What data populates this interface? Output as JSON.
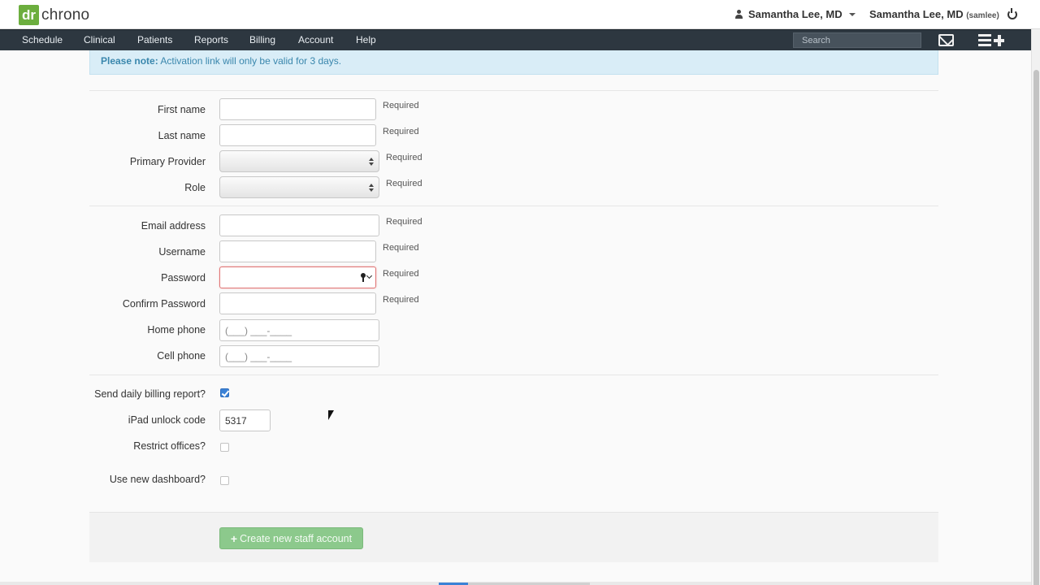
{
  "brand": {
    "logo_mark": "dr",
    "logo_text": "chrono",
    "accent_color": "#6cae3e"
  },
  "header": {
    "user_menu_label": "Samantha Lee, MD",
    "user_name": "Samantha Lee, MD",
    "user_handle": "(samlee)"
  },
  "nav": {
    "items": [
      "Schedule",
      "Clinical",
      "Patients",
      "Reports",
      "Billing",
      "Account",
      "Help"
    ],
    "search_placeholder": "Search"
  },
  "alert": {
    "strong": "Please note:",
    "text": " Activation link will only be valid for 3 days."
  },
  "form": {
    "required_text": "Required",
    "first_name": {
      "label": "First name",
      "value": ""
    },
    "last_name": {
      "label": "Last name",
      "value": ""
    },
    "primary_provider": {
      "label": "Primary Provider",
      "value": ""
    },
    "role": {
      "label": "Role",
      "value": ""
    },
    "email": {
      "label": "Email address",
      "value": ""
    },
    "username": {
      "label": "Username",
      "value": ""
    },
    "password": {
      "label": "Password",
      "value": ""
    },
    "confirm_password": {
      "label": "Confirm Password",
      "value": ""
    },
    "home_phone": {
      "label": "Home phone",
      "placeholder": "(___) ___-____"
    },
    "cell_phone": {
      "label": "Cell phone",
      "placeholder": "(___) ___-____"
    },
    "daily_billing": {
      "label": "Send daily billing report?",
      "checked": true
    },
    "ipad_unlock": {
      "label": "iPad unlock code",
      "value": "5317"
    },
    "restrict_offices": {
      "label": "Restrict offices?",
      "checked": false
    },
    "new_dashboard": {
      "label": "Use new dashboard?",
      "checked": false
    }
  },
  "actions": {
    "create_label": "Create new staff account"
  }
}
